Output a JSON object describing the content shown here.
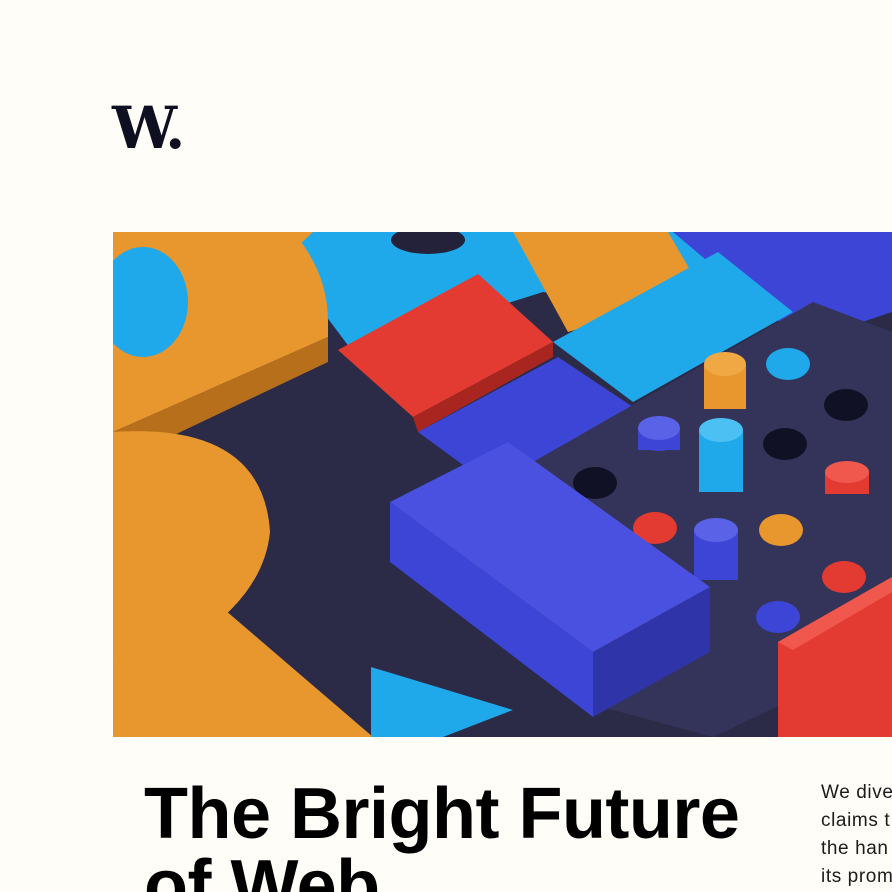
{
  "brand": {
    "logo_text": "W."
  },
  "hero": {
    "image_name": "colorful-3d-blocks-illustration",
    "colors": {
      "orange": "#e8972e",
      "blue": "#1fa9ea",
      "red": "#e33b32",
      "indigo": "#3d45d6",
      "navy": "#2b2a47"
    }
  },
  "article": {
    "headline": "The Bright Future of Web",
    "intro_lines": "We dive\nclaims t\nthe han\nits prom"
  }
}
